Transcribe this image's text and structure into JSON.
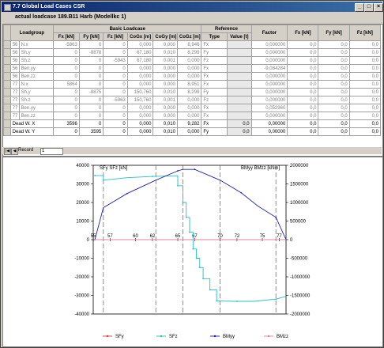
{
  "window": {
    "title": "7.7 Global Load Cases CSR",
    "buttons": [
      "_",
      "□",
      "×"
    ]
  },
  "subtitle": "actual loadcase  189.B11 Harb (Modellkc 1)",
  "table": {
    "group_basic": "Basic Loadcase",
    "group_reference": "Reference",
    "columns": [
      "Loadgroup",
      "Fx\n[kN]",
      "Fy\n[kN]",
      "Fz\n[kN]",
      "CoGx\n[m]",
      "CoGy\n[m]",
      "CoGz\n[m]",
      "Type",
      "Value\n[t]",
      "Factor",
      "Fx\n[kN]",
      "Fy\n[kN]",
      "Fz\n[kN]"
    ],
    "rows": [
      [
        "56",
        "N.x",
        "-5863",
        "0",
        "0",
        "0,000",
        "0,000",
        "8,946",
        "Fx",
        "",
        "0,000000",
        "0,0",
        "0,0",
        "0,0"
      ],
      [
        "56",
        "Sh.y",
        "0",
        "-8878",
        "0",
        "67,180",
        "0,010",
        "8,299",
        "Fy",
        "",
        "0,000000",
        "0,0",
        "0,0",
        "0,0"
      ],
      [
        "56",
        "Sh.z",
        "0",
        "0",
        "-5943",
        "67,180",
        "0,001",
        "0,000",
        "Fz",
        "",
        "0,000000",
        "0,0",
        "0,0",
        "0,0"
      ],
      [
        "56",
        "Ben.yy",
        "0",
        "0",
        "0",
        "0,000",
        "0,000",
        "0,000",
        "Fx",
        "",
        "-9,084284",
        "0,0",
        "0,0",
        "0,0"
      ],
      [
        "56",
        "Ben.zz",
        "0",
        "0",
        "0",
        "0,000",
        "0,000",
        "0,000",
        "Fx",
        "",
        "0,000000",
        "0,0",
        "0,0",
        "0,0"
      ],
      [
        "77",
        "N.x",
        "5864",
        "0",
        "0",
        "0,000",
        "0,000",
        "8,951",
        "Fx",
        "",
        "0,000000",
        "0,0",
        "0,0",
        "0,0"
      ],
      [
        "77",
        "Sh.y",
        "0",
        "-8875",
        "0",
        "150,760",
        "0,010",
        "8,299",
        "Fy",
        "",
        "0,000000",
        "0,0",
        "0,0",
        "0,0"
      ],
      [
        "77",
        "Sh.z",
        "0",
        "0",
        "-5963",
        "150,760",
        "0,001",
        "0,000",
        "Fz",
        "",
        "0,000000",
        "0,0",
        "0,0",
        "0,0"
      ],
      [
        "77",
        "Ben.yy",
        "0",
        "0",
        "0",
        "0,000",
        "0,000",
        "0,000",
        "Fx",
        "",
        "0,052960",
        "0,0",
        "0,0",
        "0,0"
      ],
      [
        "77",
        "Ben.zz",
        "0",
        "0",
        "0",
        "0,000",
        "0,000",
        "0,000",
        "Fx",
        "",
        "0,000000",
        "0,0",
        "0,0",
        "0,0"
      ],
      [
        "",
        "Dead W. X",
        "3596",
        "0",
        "0",
        "0,000",
        "0,010",
        "9,282",
        "Fx",
        "0,0",
        "0,00000",
        "0,0",
        "0,0",
        "0,0"
      ],
      [
        "",
        "Dead W. Y",
        "0",
        "3595",
        "0",
        "0,000",
        "0,010",
        "0,000",
        "Fy",
        "0,0",
        "0,00000",
        "0,0",
        "0,0",
        "0,0"
      ]
    ]
  },
  "record": {
    "label": "Record",
    "value": "1"
  },
  "chart_data": {
    "type": "line",
    "legend_top_left": "SFy SFz [kN]",
    "legend_top_right": "BMyy BMzz [kNm]",
    "x_ticks": [
      "55",
      "57",
      "60",
      "62",
      "65",
      "67",
      "70",
      "72",
      "75",
      "77"
    ],
    "x_range": [
      55,
      77.8
    ],
    "y_left_ticks": [
      "40000",
      "30000",
      "20000",
      "10000",
      "0",
      "-10000",
      "-20000",
      "-30000",
      "-40000"
    ],
    "y_left_range": [
      -40000,
      40000
    ],
    "y_right_ticks": [
      "2000000",
      "1500000",
      "1000000",
      "500000",
      "0",
      "-500000",
      "-1000000",
      "-1500000",
      "-2000000"
    ],
    "y_right_range": [
      -2000000,
      2000000
    ],
    "frame_lines_x": [
      56.2,
      62.4,
      65.6,
      70.0,
      76.6
    ],
    "series": [
      {
        "name": "SFy",
        "color": "#d04040",
        "axis": "left",
        "x": [
          55.2,
          56.2,
          62.4,
          65.0,
          70.0,
          72.5,
          76.6,
          77.8
        ],
        "y": [
          0,
          0,
          0,
          0,
          0,
          0,
          0,
          0
        ]
      },
      {
        "name": "SFz",
        "color": "#20c0c0",
        "axis": "left",
        "x": [
          55.2,
          56.2,
          56.2,
          59.0,
          62.0,
          65.0,
          65.0,
          65.6,
          65.6,
          66.0,
          66.0,
          66.4,
          66.4,
          66.8,
          66.8,
          67.2,
          67.2,
          67.6,
          67.6,
          68.0,
          68.0,
          68.8,
          68.8,
          69.6,
          69.6,
          70.0,
          72.0,
          74.0,
          76.6,
          77.8
        ],
        "y": [
          34500,
          34500,
          32000,
          33300,
          34000,
          34400,
          29000,
          29000,
          20000,
          20000,
          12000,
          12000,
          4000,
          4000,
          -5000,
          -5000,
          -10000,
          -10000,
          -15000,
          -15000,
          -21000,
          -21000,
          -27000,
          -27000,
          -33000,
          -33000,
          -33200,
          -33200,
          -32000,
          -30500
        ]
      },
      {
        "name": "BMyy",
        "color": "#2020b0",
        "axis": "right",
        "x": [
          55.2,
          56.2,
          59.0,
          62.4,
          65.0,
          65.6,
          67.0,
          70.0,
          72.5,
          74.5,
          76.6,
          77.8
        ],
        "y": [
          0,
          860000,
          1240000,
          1600000,
          1850000,
          1890000,
          1890000,
          1600000,
          1260000,
          900000,
          600000,
          0
        ]
      },
      {
        "name": "BMzz",
        "color": "#e080a0",
        "axis": "right",
        "x": [
          55.2,
          77.8
        ],
        "y": [
          0,
          0
        ]
      }
    ],
    "legend": [
      "SFy",
      "SFz",
      "BMyy",
      "BMzz"
    ]
  }
}
